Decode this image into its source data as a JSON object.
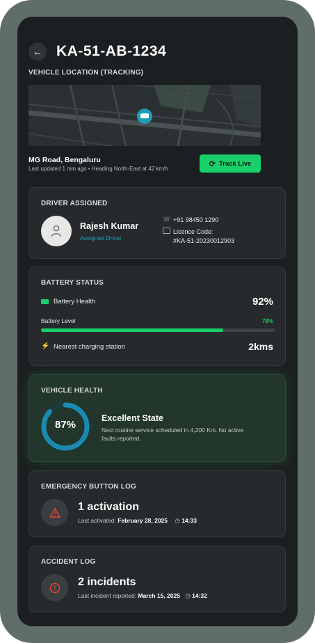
{
  "header": {
    "plate": "KA-51-AB-1234"
  },
  "location": {
    "section_title": "VEHICLE LOCATION (TRACKING)",
    "place": "MG Road, Bengaluru",
    "update_line": "Last updated 1 min ago • Heading North-East at 42 km/h",
    "track_button": "Track Live"
  },
  "driver": {
    "section_title": "DRIVER ASSIGNED",
    "name": "Rajesh Kumar",
    "role": "Assigned Driver",
    "phone": "+91 98450 1290",
    "licence_label": "Licence Code:",
    "licence_value": "#KA-51-20230012903"
  },
  "battery": {
    "section_title": "BATTERY STATUS",
    "health_label": "Battery Health",
    "health_value": "92%",
    "level_label": "Battery Level",
    "level_value": "78%",
    "level_fraction": 0.78,
    "station_label": "Nearest charging station",
    "station_value": "2kms"
  },
  "health": {
    "section_title": "VEHICLE HEALTH",
    "percent_text": "87%",
    "fraction": 0.87,
    "state": "Excellent State",
    "description": "Next routine service scheduled in 4,200 Km. No active faults reported."
  },
  "emergency": {
    "section_title": "EMERGENCY BUTTON LOG",
    "count": "1 activation",
    "last_prefix": "Last activated:",
    "date": "February 28, 2025",
    "time": "14:33"
  },
  "accident": {
    "section_title": "ACCIDENT LOG",
    "count": "2 incidents",
    "last_prefix": "Last incident reported:",
    "date": "March 15, 2025",
    "time": "14:32"
  },
  "colors": {
    "accent_green": "#19cf6a",
    "ring_blue": "#1a8bb0",
    "teal_text": "#1f9db8"
  }
}
